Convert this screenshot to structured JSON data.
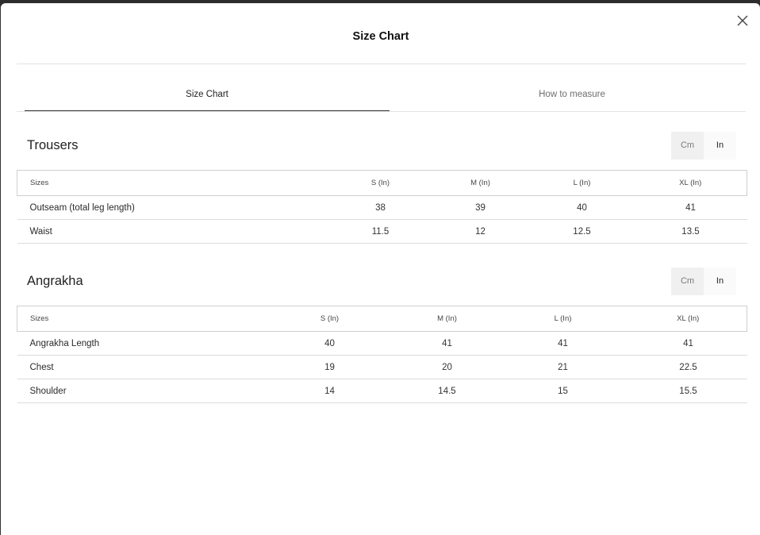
{
  "modal": {
    "title": "Size Chart",
    "tabs": [
      {
        "label": "Size Chart",
        "active": true
      },
      {
        "label": "How to measure",
        "active": false
      }
    ]
  },
  "unit_toggle": {
    "options": [
      "Cm",
      "In"
    ],
    "selected": "In"
  },
  "sections": [
    {
      "title": "Trousers",
      "columns": [
        "Sizes",
        "S (In)",
        "M (In)",
        "L (In)",
        "XL (In)"
      ],
      "rows": [
        [
          "Outseam (total leg length)",
          "38",
          "39",
          "40",
          "41"
        ],
        [
          "Waist",
          "11.5",
          "12",
          "12.5",
          "13.5"
        ]
      ]
    },
    {
      "title": "Angrakha",
      "columns": [
        "Sizes",
        "S (In)",
        "M (In)",
        "L (In)",
        "XL (In)"
      ],
      "rows": [
        [
          "Angrakha Length",
          "40",
          "41",
          "41",
          "41"
        ],
        [
          "Chest",
          "19",
          "20",
          "21",
          "22.5"
        ],
        [
          "Shoulder",
          "14",
          "14.5",
          "15",
          "15.5"
        ]
      ]
    }
  ]
}
